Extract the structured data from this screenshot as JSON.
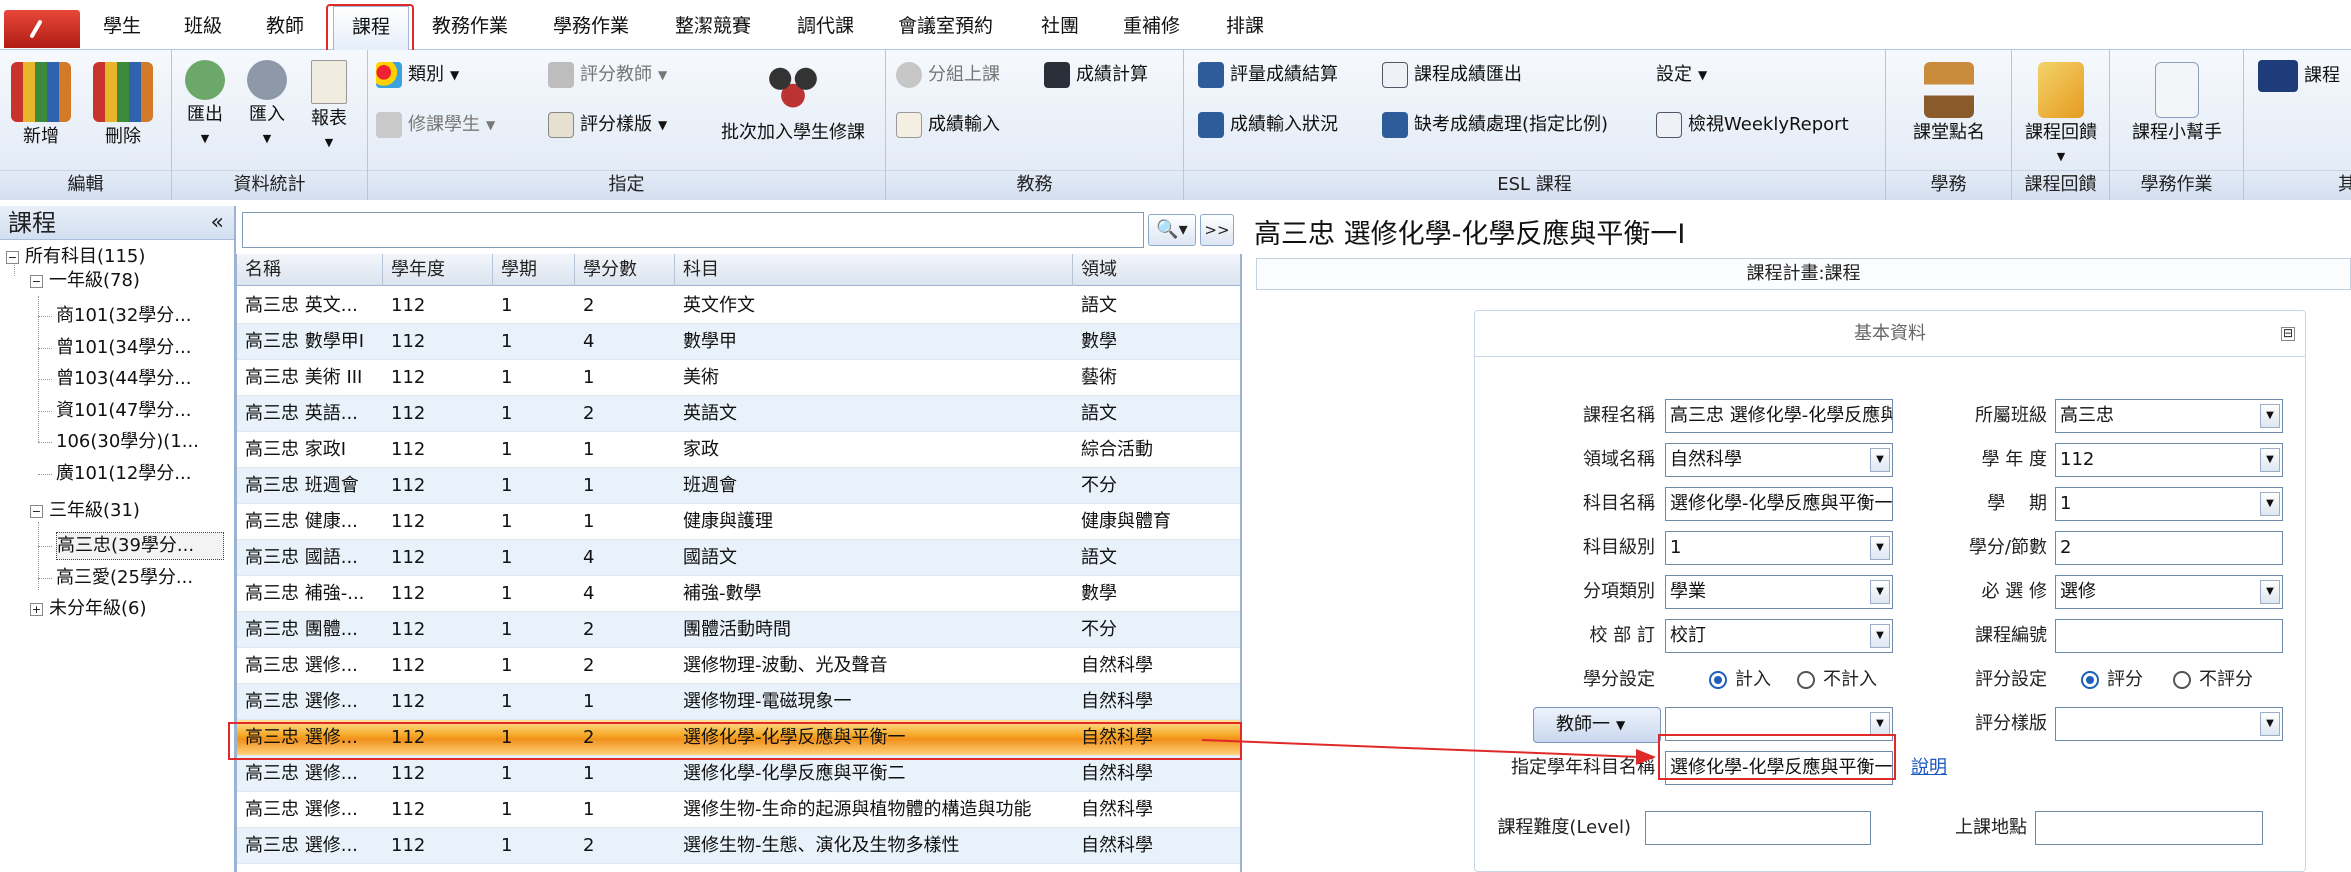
{
  "menu": {
    "tabs": [
      "學生",
      "班級",
      "教師",
      "課程",
      "教務作業",
      "學務作業",
      "整潔競賽",
      "調代課",
      "會議室預約",
      "社團",
      "重補修",
      "排課"
    ],
    "active_tab": "課程"
  },
  "ribbon": {
    "edit": {
      "label": "編輯",
      "add": "新增",
      "delete": "刪除"
    },
    "stats": {
      "label": "資料統計",
      "export": "匯出",
      "import": "匯入",
      "report": "報表"
    },
    "assign": {
      "label": "指定",
      "category": "類別",
      "students": "修課學生",
      "grading_teacher": "評分教師",
      "grading_template": "評分樣版",
      "batch_add": "批次加入學生修課"
    },
    "academic": {
      "label": "教務",
      "group_class": "分組上課",
      "score_calc": "成績計算",
      "score_input": "成績輸入"
    },
    "esl": {
      "label": "ESL 課程",
      "eval_calc": "評量成績結算",
      "input_status": "成績輸入狀況",
      "export_scores": "課程成績匯出",
      "missing_scores": "缺考成績處理(指定比例)",
      "settings": "設定",
      "weekly": "檢視WeeklyReport"
    },
    "student_affairs": {
      "label": "學務",
      "attendance": "課堂點名"
    },
    "course_review": {
      "label": "課程回饋",
      "review": "課程回饋"
    },
    "sa_work": {
      "label": "學務作業",
      "helper": "課程小幫手"
    },
    "extra": {
      "item": "課程",
      "label": "其"
    }
  },
  "left_panel": {
    "title": "課程",
    "collapse": "«",
    "tree": {
      "root": "所有科目(115)",
      "grade1": "一年級(78)",
      "grade1_items": [
        "商101(32學分...",
        "曾101(34學分...",
        "曾103(44學分...",
        "資101(47學分...",
        "106(30學分)(1...",
        "廣101(12學分..."
      ],
      "grade3": "三年級(31)",
      "grade3_items": [
        "高三忠(39學分...",
        "高三愛(25學分..."
      ],
      "ungraded": "未分年級(6)"
    }
  },
  "list": {
    "search_value": "",
    "search_btn": "🔍▾",
    "next_btn": ">>",
    "columns": [
      "名稱",
      "學年度",
      "學期",
      "學分數",
      "科目",
      "領域"
    ],
    "rows": [
      [
        "高三忠 英文...",
        "112",
        "1",
        "2",
        "英文作文",
        "語文"
      ],
      [
        "高三忠 數學甲Ⅰ",
        "112",
        "1",
        "4",
        "數學甲",
        "數學"
      ],
      [
        "高三忠 美術 III",
        "112",
        "1",
        "1",
        "美術",
        "藝術"
      ],
      [
        "高三忠 英語...",
        "112",
        "1",
        "2",
        "英語文",
        "語文"
      ],
      [
        "高三忠 家政Ⅰ",
        "112",
        "1",
        "1",
        "家政",
        "綜合活動"
      ],
      [
        "高三忠 班週會",
        "112",
        "1",
        "1",
        "班週會",
        "不分"
      ],
      [
        "高三忠 健康...",
        "112",
        "1",
        "1",
        "健康與護理",
        "健康與體育"
      ],
      [
        "高三忠 國語...",
        "112",
        "1",
        "4",
        "國語文",
        "語文"
      ],
      [
        "高三忠 補強-...",
        "112",
        "1",
        "4",
        "補強-數學",
        "數學"
      ],
      [
        "高三忠 團體...",
        "112",
        "1",
        "2",
        "團體活動時間",
        "不分"
      ],
      [
        "高三忠 選修...",
        "112",
        "1",
        "2",
        "選修物理-波動、光及聲音",
        "自然科學"
      ],
      [
        "高三忠 選修...",
        "112",
        "1",
        "1",
        "選修物理-電磁現象一",
        "自然科學"
      ],
      [
        "高三忠 選修...",
        "112",
        "1",
        "2",
        "選修化學-化學反應與平衡一",
        "自然科學"
      ],
      [
        "高三忠 選修...",
        "112",
        "1",
        "1",
        "選修化學-化學反應與平衡二",
        "自然科學"
      ],
      [
        "高三忠 選修...",
        "112",
        "1",
        "1",
        "選修生物-生命的起源與植物體的構造與功能",
        "自然科學"
      ],
      [
        "高三忠 選修...",
        "112",
        "1",
        "2",
        "選修生物-生態、演化及生物多樣性",
        "自然科學"
      ]
    ],
    "selected_index": 12
  },
  "detail": {
    "title": "高三忠 選修化學-化學反應與平衡一Ⅰ",
    "subheader": "課程計畫:課程",
    "card_title": "基本資料",
    "card_min": "⊟",
    "labels": {
      "course_name": "課程名稱",
      "domain": "領域名稱",
      "subject": "科目名稱",
      "subject_level": "科目級別",
      "category": "分項類別",
      "dept": "校 部 訂",
      "credit_setting": "學分設定",
      "teacher": "教師一",
      "assigned_subject": "指定學年科目名稱",
      "class": "所屬班級",
      "year": "學 年 度",
      "semester": "學　 期",
      "credits": "學分/節數",
      "required": "必 選 修",
      "course_code": "課程編號",
      "grade_setting": "評分設定",
      "grade_template": "評分樣版",
      "level": "課程難度(Level)",
      "location": "上課地點"
    },
    "values": {
      "course_name": "高三忠 選修化學-化學反應與平衡一Ⅰ",
      "domain": "自然科學",
      "subject": "選修化學-化學反應與平衡一",
      "subject_level": "1",
      "category": "學業",
      "dept": "校訂",
      "teacher": "",
      "assigned_subject": "選修化學-化學反應與平衡一",
      "class": "高三忠",
      "year": "112",
      "semester": "1",
      "credits": "2",
      "required": "選修",
      "course_code": "",
      "grade_template": "",
      "level": "",
      "location": ""
    },
    "credit_options": [
      "計入",
      "不計入"
    ],
    "grade_options": [
      "評分",
      "不評分"
    ],
    "help": "說明"
  },
  "colors": {
    "highlight": "#e02a2a",
    "link": "#1a55c4"
  }
}
